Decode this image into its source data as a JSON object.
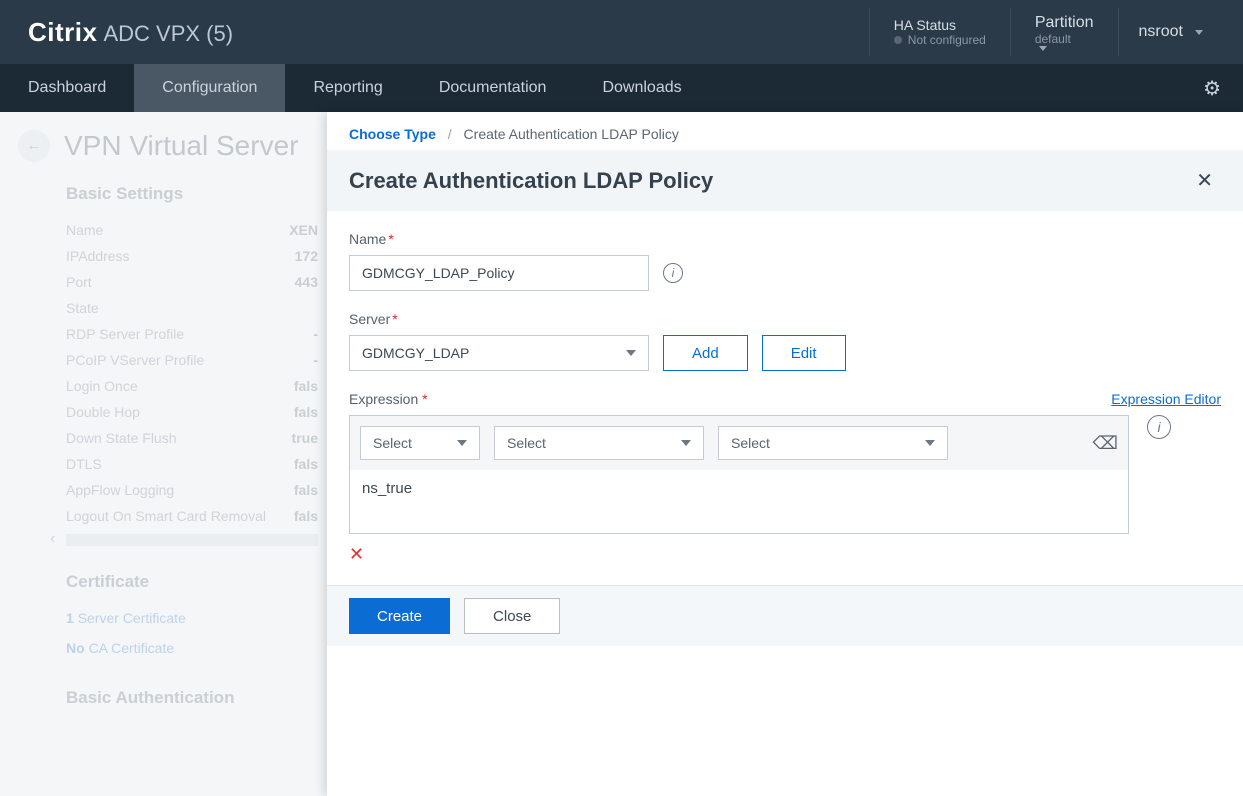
{
  "brand": {
    "citrix": "Citrix",
    "product": "ADC VPX (5)"
  },
  "topbar": {
    "haTitle": "HA Status",
    "haStatus": "Not configured",
    "partitionLabel": "Partition",
    "partitionValue": "default",
    "user": "nsroot"
  },
  "nav": {
    "items": [
      "Dashboard",
      "Configuration",
      "Reporting",
      "Documentation",
      "Downloads"
    ],
    "activeIndex": 1
  },
  "backgroundPage": {
    "title": "VPN Virtual Server",
    "basicSettingsHeader": "Basic Settings",
    "kv": [
      {
        "k": "Name",
        "v": "XEN"
      },
      {
        "k": "IPAddress",
        "v": "172"
      },
      {
        "k": "Port",
        "v": "443"
      },
      {
        "k": "State",
        "v": ""
      },
      {
        "k": "RDP Server Profile",
        "v": "-"
      },
      {
        "k": "PCoIP VServer Profile",
        "v": "-"
      },
      {
        "k": "Login Once",
        "v": "fals"
      },
      {
        "k": "Double Hop",
        "v": "fals"
      },
      {
        "k": "Down State Flush",
        "v": "true"
      },
      {
        "k": "DTLS",
        "v": "fals"
      },
      {
        "k": "AppFlow Logging",
        "v": "fals"
      },
      {
        "k": "Logout On Smart Card Removal",
        "v": "fals"
      }
    ],
    "certHeader": "Certificate",
    "serverCertCount": "1",
    "serverCertLabel": "Server Certificate",
    "caCertCount": "No",
    "caCertLabel": "CA Certificate",
    "basicAuthHeader": "Basic Authentication"
  },
  "panel": {
    "crumb1": "Choose Type",
    "crumb2": "Create Authentication LDAP Policy",
    "title": "Create Authentication LDAP Policy",
    "nameLabel": "Name",
    "nameValue": "GDMCGY_LDAP_Policy",
    "serverLabel": "Server",
    "serverValue": "GDMCGY_LDAP",
    "addBtn": "Add",
    "editBtn": "Edit",
    "expressionLabel": "Expression",
    "expressionEditorLink": "Expression Editor",
    "selectPlaceholder": "Select",
    "expressionValue": "ns_true",
    "createBtn": "Create",
    "closeBtn": "Close"
  }
}
